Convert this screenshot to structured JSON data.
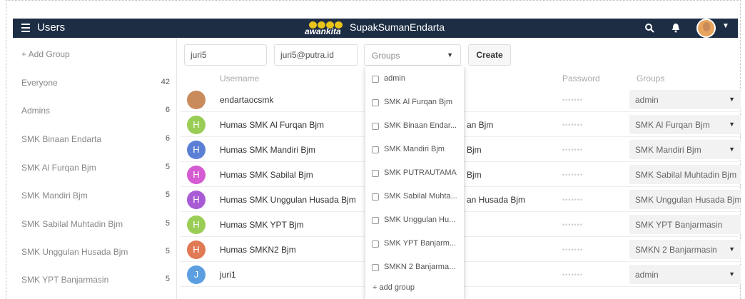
{
  "header": {
    "title": "Users",
    "logo_text": "awankita",
    "site_name": "SupakSumanEndarta"
  },
  "sidebar": {
    "add_group_label": "+ Add Group",
    "groups": [
      {
        "name": "Everyone",
        "count": "42"
      },
      {
        "name": "Admins",
        "count": "6"
      },
      {
        "name": "SMK Binaan Endarta",
        "count": "6"
      },
      {
        "name": "SMK Al Furqan Bjm",
        "count": "5"
      },
      {
        "name": "SMK Mandiri Bjm",
        "count": "5"
      },
      {
        "name": "SMK Sabilal Muhtadin Bjm",
        "count": "5"
      },
      {
        "name": "SMK Unggulan Husada Bjm",
        "count": "5"
      },
      {
        "name": "SMK YPT Banjarmasin",
        "count": "5"
      }
    ]
  },
  "toolbar": {
    "username_value": "juri5",
    "email_value": "juri5@putra.id",
    "groups_placeholder": "Groups",
    "create_label": "Create"
  },
  "table": {
    "headers": {
      "username": "Username",
      "password": "Password",
      "groups": "Groups"
    },
    "rows": [
      {
        "avatar": "",
        "avatar_color": "#c98a5c",
        "username": "endartaocsmk",
        "display_name": "",
        "password": "•••••••",
        "group": "admin",
        "has_caret": true
      },
      {
        "avatar": "H",
        "avatar_color": "#9acd55",
        "username": "Humas SMK Al Furqan Bjm",
        "display_name": "an Bjm",
        "password": "•••••••",
        "group": "SMK Al Furqan Bjm",
        "has_caret": true
      },
      {
        "avatar": "H",
        "avatar_color": "#5b7fd4",
        "username": "Humas SMK Mandiri Bjm",
        "display_name": "Bjm",
        "password": "•••••••",
        "group": "SMK Mandiri Bjm",
        "has_caret": true
      },
      {
        "avatar": "H",
        "avatar_color": "#d45bd1",
        "username": "Humas SMK Sabilal Bjm",
        "display_name": "Bjm",
        "password": "•••••••",
        "group": "SMK Sabilal Muhtadin Bjm",
        "has_caret": false
      },
      {
        "avatar": "H",
        "avatar_color": "#a85bd4",
        "username": "Humas SMK Unggulan Husada Bjm",
        "display_name": "an Husada Bjm",
        "password": "•••••••",
        "group": "SMK Unggulan Husada Bjm",
        "has_caret": false
      },
      {
        "avatar": "H",
        "avatar_color": "#9acd55",
        "username": "Humas SMK YPT Bjm",
        "display_name": "",
        "password": "•••••••",
        "group": "SMK YPT Banjarmasin",
        "has_caret": false
      },
      {
        "avatar": "H",
        "avatar_color": "#e07a55",
        "username": "Humas SMKN2 Bjm",
        "display_name": "",
        "password": "•••••••",
        "group": "SMKN 2 Banjarmasin",
        "has_caret": true
      },
      {
        "avatar": "J",
        "avatar_color": "#5b9fe0",
        "username": "juri1",
        "display_name": "",
        "password": "•••••••",
        "group": "admin",
        "has_caret": true
      }
    ]
  },
  "dropdown": {
    "items": [
      "admin",
      "SMK Al Furqan Bjm",
      "SMK Binaan Endar...",
      "SMK Mandiri Bjm",
      "SMK PUTRAUTAMA",
      "SMK Sabilal Muhta...",
      "SMK Unggulan Hu...",
      "SMK YPT Banjarm...",
      "SMKN 2 Banjarma..."
    ],
    "add_group_label": "+ add group"
  }
}
